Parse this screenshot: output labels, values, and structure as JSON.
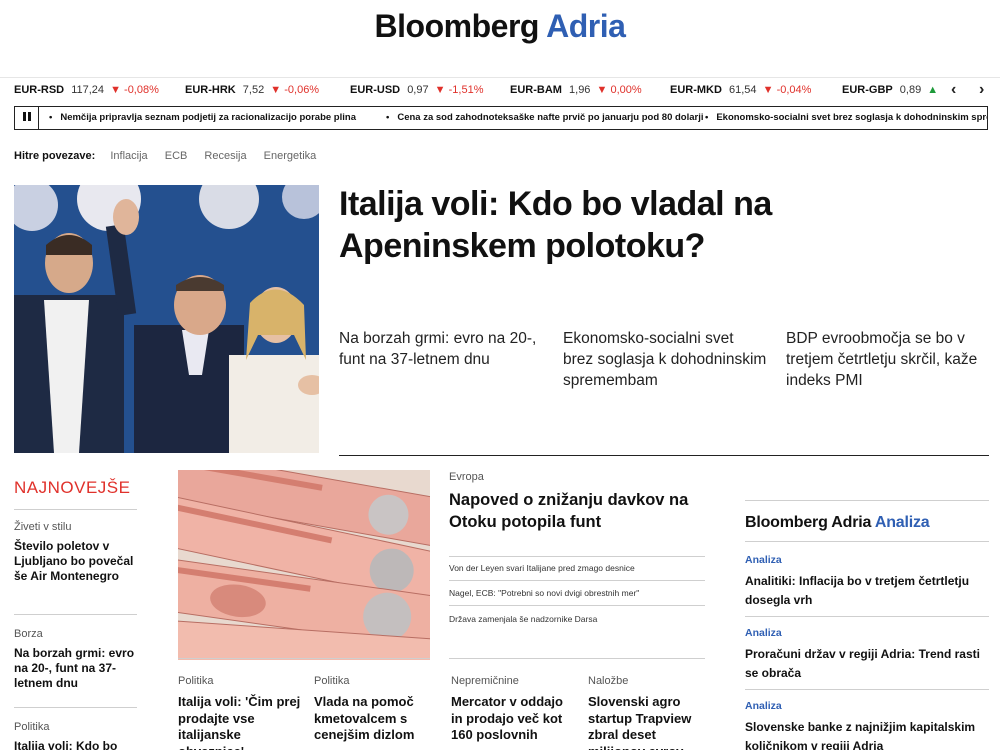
{
  "header": {
    "logo_part1": "Bloomberg",
    "logo_part2": "Adria",
    "brand_color": "#2f5fb3"
  },
  "ticker": {
    "items": [
      {
        "pair": "EUR-RSD",
        "value": "117,24",
        "change": "-0,08%",
        "direction": "down"
      },
      {
        "pair": "EUR-HRK",
        "value": "7,52",
        "change": "-0,06%",
        "direction": "down"
      },
      {
        "pair": "EUR-USD",
        "value": "0,97",
        "change": "-1,51%",
        "direction": "down"
      },
      {
        "pair": "EUR-BAM",
        "value": "1,96",
        "change": "0,00%",
        "direction": "down"
      },
      {
        "pair": "EUR-MKD",
        "value": "61,54",
        "change": "-0,04%",
        "direction": "down"
      },
      {
        "pair": "EUR-GBP",
        "value": "0,89",
        "change": "",
        "direction": "up"
      }
    ],
    "prev_icon": "chevron-left-icon",
    "next_icon": "chevron-right-icon",
    "down_color": "#e0312b",
    "up_color": "#1e9a3a"
  },
  "news_strip": {
    "items": [
      "Nemčija pripravlja seznam podjetij za racionalizacijo porabe plina",
      "Cena za sod zahodnoteksaške nafte prvič po januarju pod 80 dolarji",
      "Ekonomsko-socialni svet brez soglasja k dohodninskim spre"
    ]
  },
  "quick_links": {
    "label": "Hitre povezave:",
    "links": [
      "Inflacija",
      "ECB",
      "Recesija",
      "Energetika"
    ]
  },
  "hero": {
    "title": "Italija voli: Kdo bo vladal na Apeninskem polotoku?",
    "sub_links": [
      "Na borzah grmi: evro na 20-, funt na 37-letnem dnu",
      "Ekonomsko-socialni svet brez soglasja k dohodninskim spremembam",
      "BDP evroobmočja se bo v tretjem četrtletju skrčil, kaže indeks PMI"
    ]
  },
  "latest": {
    "heading": "NAJNOVEJŠE",
    "items": [
      {
        "category": "Živeti v stilu",
        "title": "Število poletov v Ljubljano bo povečal še Air Montenegro"
      },
      {
        "category": "Borza",
        "title": "Na borzah grmi: evro na 20-, funt na 37-letnem dnu"
      },
      {
        "category": "Politika",
        "title": "Italija voli: Kdo bo"
      }
    ]
  },
  "europe": {
    "category": "Evropa",
    "title": "Napoved o znižanju davkov na Otoku potopila funt",
    "related": [
      "Von der Leyen svari Italijane pred zmago desnice",
      "Nagel, ECB: \"Potrebni so novi dvigi obrestnih mer\"",
      "Država zamenjala še nadzornike Darsa"
    ]
  },
  "cards": [
    {
      "category": "Politika",
      "title": "Italija voli: 'Čim prej prodajte vse italijanske obveznice'"
    },
    {
      "category": "Politika",
      "title": "Vlada na pomoč kmetovalcem s cenejšim dizlom"
    },
    {
      "category": "Nepremičnine",
      "title": "Mercator v oddajo in prodajo več kot 160 poslovnih"
    },
    {
      "category": "Naložbe",
      "title": "Slovenski agro startup Trapview zbral deset milijonov evrov"
    }
  ],
  "analysis": {
    "heading_part1": "Bloomberg Adria",
    "heading_part2": "Analiza",
    "items": [
      {
        "category": "Analiza",
        "title": "Analitiki: Inflacija bo v tretjem četrtletju dosegla vrh"
      },
      {
        "category": "Analiza",
        "title": "Proračuni držav v regiji Adria: Trend rasti se obrača"
      },
      {
        "category": "Analiza",
        "title": "Slovenske banke z najnižjim kapitalskim količnikom v regiji Adria"
      }
    ]
  }
}
